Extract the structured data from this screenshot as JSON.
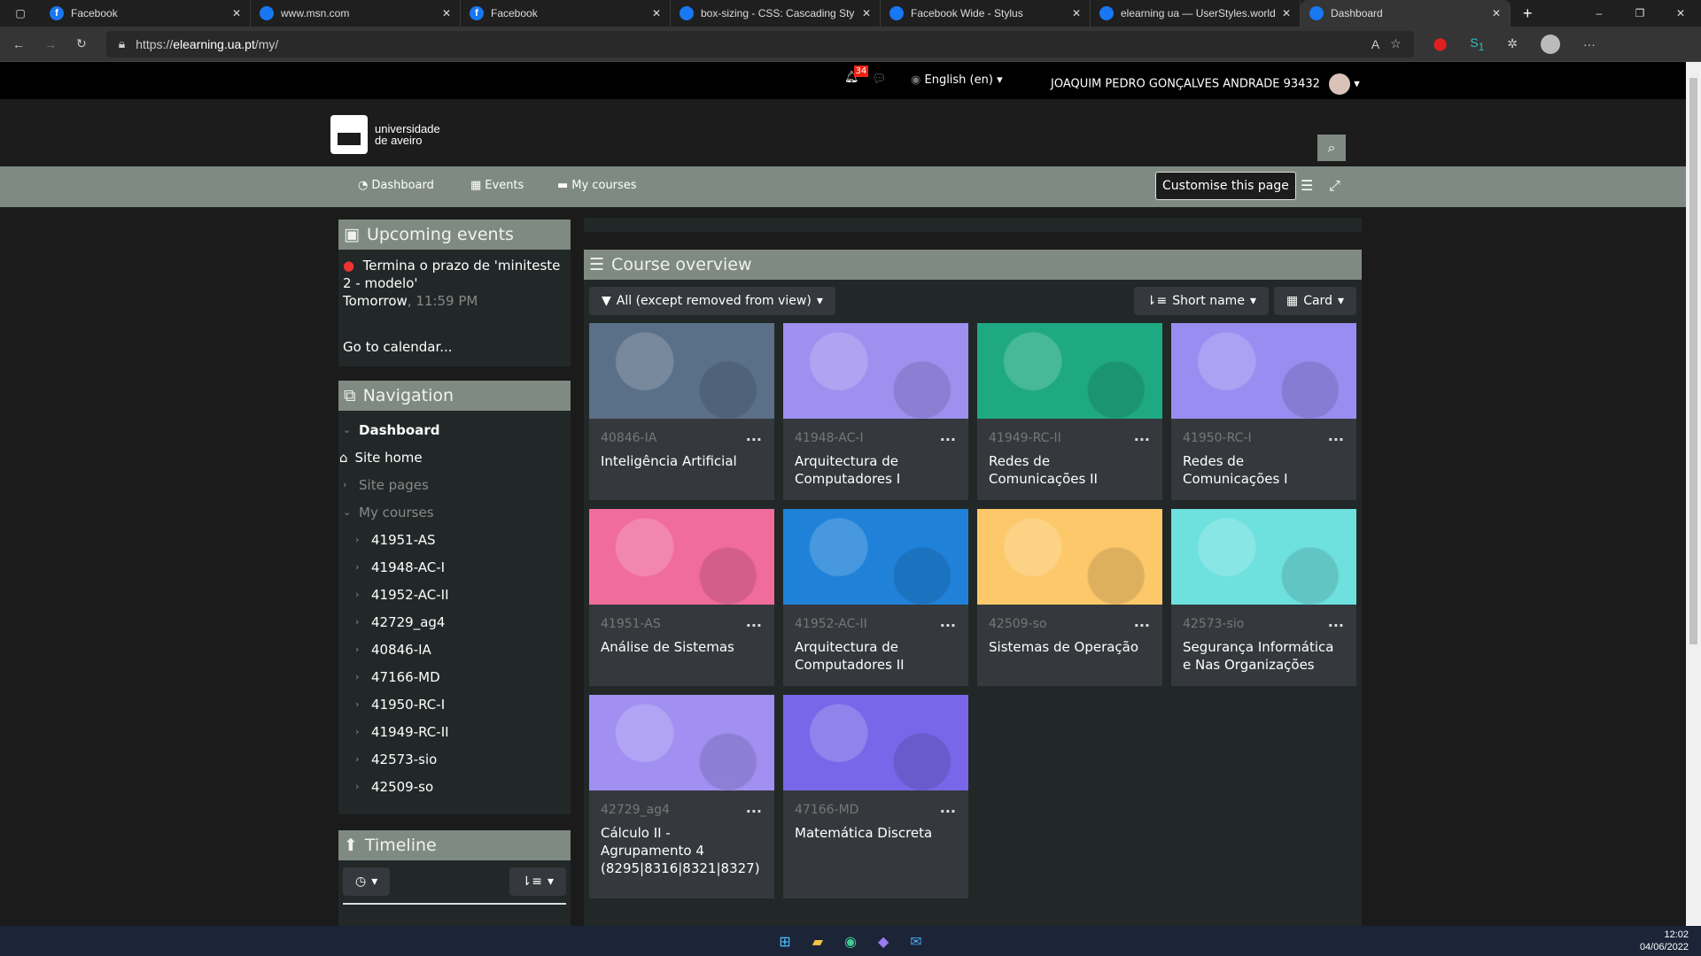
{
  "browser": {
    "tabs": [
      {
        "title": "Facebook",
        "icon": "facebook-icon"
      },
      {
        "title": "www.msn.com",
        "icon": "page-icon"
      },
      {
        "title": "Facebook",
        "icon": "facebook-icon"
      },
      {
        "title": "box-sizing - CSS: Cascading Style Sheets",
        "icon": "mdn-icon"
      },
      {
        "title": "Facebook Wide - Stylus",
        "icon": "stylus-icon"
      },
      {
        "title": "elearning ua — UserStyles.world",
        "icon": "userstyles-icon"
      },
      {
        "title": "Dashboard",
        "icon": "moodle-icon",
        "active": true
      }
    ],
    "url_prefix": "https://",
    "url_host": "elearning.ua.pt",
    "url_path": "/my/",
    "extension_badge": "1"
  },
  "topnav": {
    "notifications_count": "34",
    "language": "English (en)",
    "user": "JOAQUIM PEDRO GONÇALVES ANDRADE 93432"
  },
  "logo": {
    "line1": "universidade",
    "line2": "de aveiro"
  },
  "nav": {
    "items": [
      "Dashboard",
      "Events",
      "My courses"
    ],
    "customise": "Customise this page"
  },
  "upcoming": {
    "title": "Upcoming events",
    "event": "Termina o prazo de 'miniteste 2 - modelo'",
    "day": "Tomorrow",
    "time": ", 11:59 PM",
    "calendar_link": "Go to calendar..."
  },
  "navigation": {
    "title": "Navigation",
    "dashboard": "Dashboard",
    "site_home": "Site home",
    "site_pages": "Site pages",
    "my_courses": "My courses",
    "courses": [
      "41951-AS",
      "41948-AC-I",
      "41952-AC-II",
      "42729_ag4",
      "40846-IA",
      "47166-MD",
      "41950-RC-I",
      "41949-RC-II",
      "42573-sio",
      "42509-so"
    ]
  },
  "timeline": {
    "title": "Timeline"
  },
  "overview": {
    "title": "Course overview",
    "filter": "All (except removed from view)",
    "sort": "Short name",
    "view": "Card",
    "courses": [
      {
        "short": "40846-IA",
        "name": "Inteligência Artificial",
        "color": "#5a6f88"
      },
      {
        "short": "41948-AC-I",
        "name": "Arquitectura de Computadores I",
        "color": "#9f8fef"
      },
      {
        "short": "41949-RC-II",
        "name": "Redes de Comunicações II",
        "color": "#1fa983"
      },
      {
        "short": "41950-RC-I",
        "name": "Redes de Comunicações I",
        "color": "#9a8cf0"
      },
      {
        "short": "41951-AS",
        "name": "Análise de Sistemas",
        "color": "#f06c9b"
      },
      {
        "short": "41952-AC-II",
        "name": "Arquitectura de Computadores II",
        "color": "#1f82d8"
      },
      {
        "short": "42509-so",
        "name": "Sistemas de Operação",
        "color": "#fcc86a"
      },
      {
        "short": "42573-sio",
        "name": "Segurança Informática e Nas Organizações",
        "color": "#6ee0de"
      },
      {
        "short": "42729_ag4",
        "name": "Cálculo II - Agrupamento 4 (8295|8316|8321|8327)",
        "color": "#a190f2"
      },
      {
        "short": "47166-MD",
        "name": "Matemática Discreta",
        "color": "#7a66e8"
      }
    ]
  },
  "taskbar": {
    "time": "12:02",
    "date": "04/06/2022"
  }
}
